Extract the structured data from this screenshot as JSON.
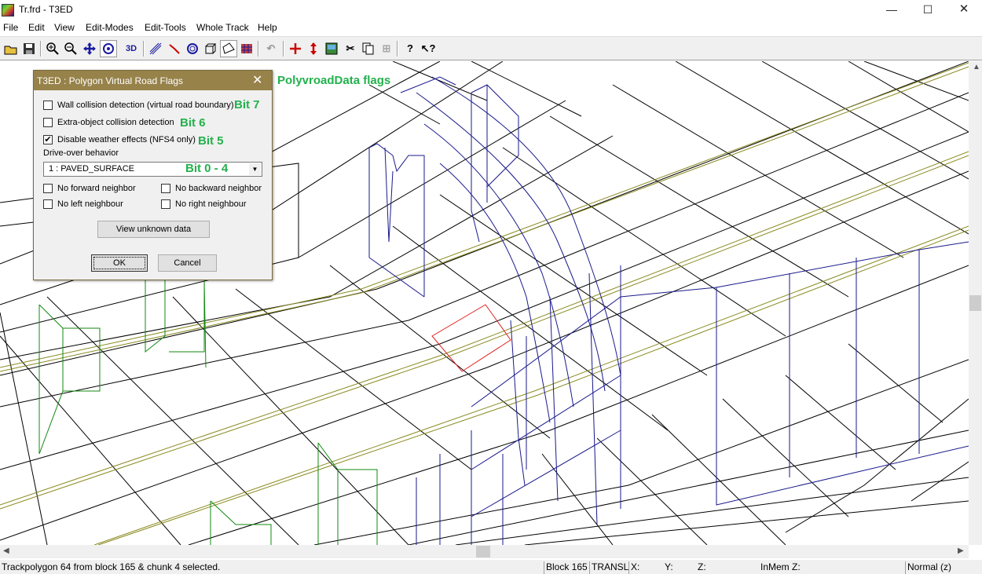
{
  "window": {
    "title": "Tr.frd - T3ED",
    "minimize": "—",
    "maximize": "☐",
    "close": "✕"
  },
  "menu": [
    "File",
    "Edit",
    "View",
    "Edit-Modes",
    "Edit-Tools",
    "Whole Track",
    "Help"
  ],
  "toolbar": {
    "icons": [
      "open-icon",
      "save-icon",
      "zoom-in-icon",
      "zoom-out-icon",
      "move-icon",
      "rotate-icon",
      "3d-view-icon",
      "track-icon",
      "path-icon",
      "object-icon",
      "block-icon",
      "polygon-icon",
      "texture-grid-icon",
      "undo-icon",
      "cross-move-icon",
      "vertical-move-icon",
      "image-icon",
      "cut-icon",
      "copy-icon",
      "paste-icon",
      "help-icon",
      "context-help-icon"
    ],
    "labels": {
      "3d": "3D"
    }
  },
  "annotations": {
    "title": "PolyvroadData flags",
    "bit7": "Bit 7",
    "bit6": "Bit 6",
    "bit5": "Bit 5",
    "bit04": "Bit 0 - 4"
  },
  "dialog": {
    "title": "T3ED : Polygon Virtual Road Flags",
    "close": "✕",
    "checks": [
      {
        "label": "Wall collision detection (virtual road boundary)",
        "checked": false
      },
      {
        "label": "Extra-object collision detection",
        "checked": false
      },
      {
        "label": "Disable weather effects (NFS4 only)",
        "checked": true
      }
    ],
    "drive_over_label": "Drive-over behavior",
    "drive_over_value": "1 : PAVED_SURFACE",
    "neighbors": [
      {
        "label": "No forward neighbor",
        "checked": false
      },
      {
        "label": "No backward neighbor",
        "checked": false
      },
      {
        "label": "No left neighbour",
        "checked": false
      },
      {
        "label": "No right neighbour",
        "checked": false
      }
    ],
    "view_unknown": "View unknown data",
    "ok": "OK",
    "cancel": "Cancel"
  },
  "status": {
    "message": "Trackpolygon 64 from block 165 & chunk 4 selected.",
    "block": "Block 165",
    "mode": "TRANSL",
    "x": "X:",
    "y": "Y:",
    "z": "Z:",
    "inmem": "InMem Z:",
    "view": "Normal (z)"
  },
  "colors": {
    "dialog_title_bg": "#97824a",
    "annotation": "#22b14c",
    "wire_black": "#000000",
    "wire_blue": "#1a1a8c",
    "wire_green": "#118811",
    "wire_olive": "#8a8a20",
    "selected": "#e02020"
  }
}
